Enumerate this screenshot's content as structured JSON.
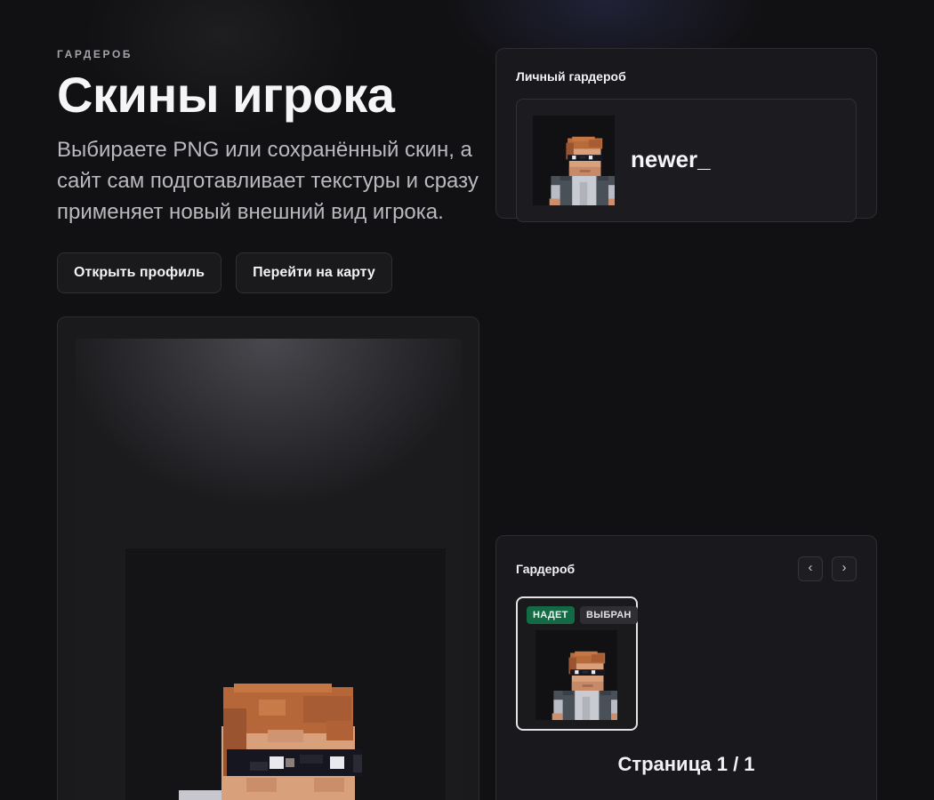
{
  "hero": {
    "eyebrow": "ГАРДЕРОБ",
    "title": "Скины игрока",
    "description": "Выбираете PNG или сохранённый скин, а сайт сам подготавливает текстуры и сразу применяет новый внешний вид игрока."
  },
  "actions": {
    "open_profile": "Открыть профиль",
    "go_to_map": "Перейти на карту"
  },
  "personal": {
    "title": "Личный гардероб",
    "skin_name": "newer_"
  },
  "wardrobe": {
    "title": "Гардероб",
    "prev": "‹",
    "next": "›",
    "cards": [
      {
        "badge_worn": "НАДЕТ",
        "badge_selected": "ВЫБРАН"
      }
    ],
    "page_label": "Страница 1 / 1"
  },
  "colors": {
    "background": "#111113",
    "badge_worn": "#126b45",
    "badge_selected": "#2e2e33"
  }
}
